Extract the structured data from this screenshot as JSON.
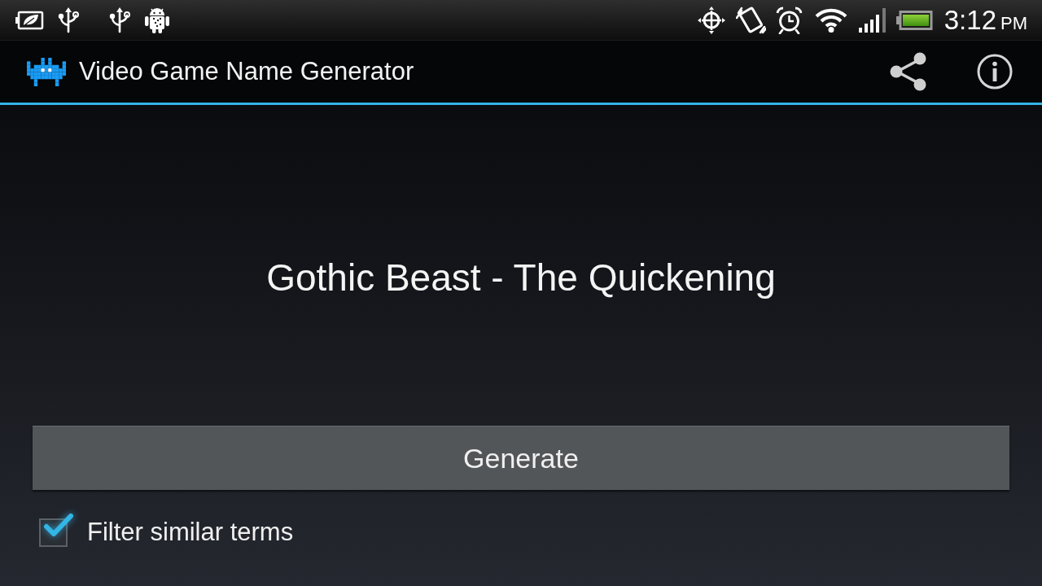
{
  "status_bar": {
    "time": "3:12",
    "meridiem": "PM"
  },
  "action_bar": {
    "title": "Video Game Name Generator"
  },
  "generated_name": "Gothic Beast - The Quickening",
  "generate_button": {
    "label": "Generate"
  },
  "filter_option": {
    "label": "Filter similar terms",
    "checked": true
  }
}
